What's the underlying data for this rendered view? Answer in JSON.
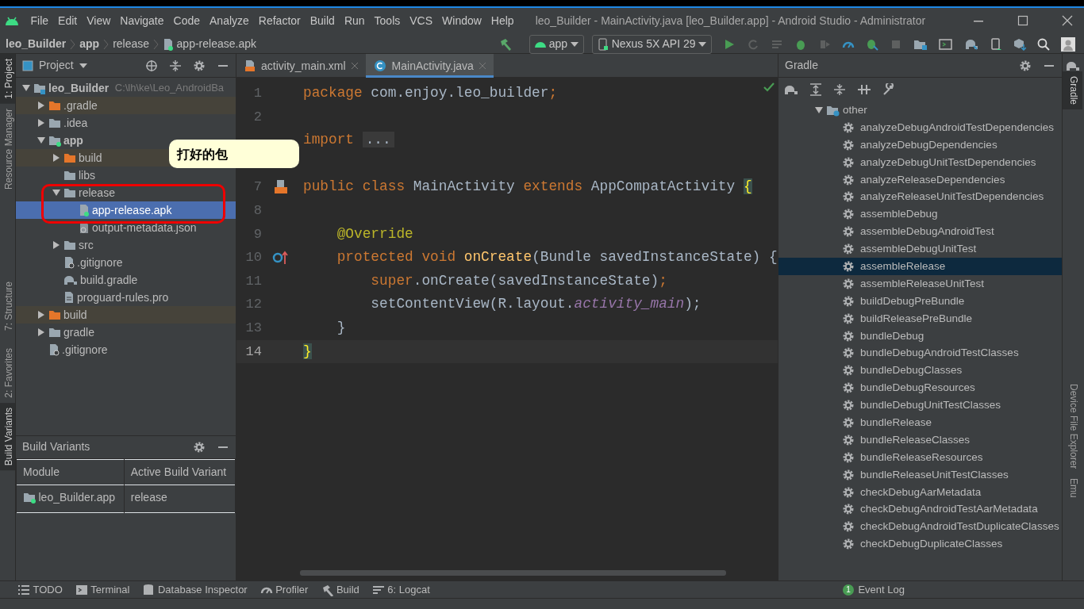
{
  "menu": [
    "File",
    "Edit",
    "View",
    "Navigate",
    "Code",
    "Analyze",
    "Refactor",
    "Build",
    "Run",
    "Tools",
    "VCS",
    "Window",
    "Help"
  ],
  "window_title": "leo_Builder - MainActivity.java [leo_Builder.app] - Android Studio - Administrator",
  "breadcrumb": [
    {
      "label": "leo_Builder",
      "bold": true,
      "kind": "text"
    },
    {
      "label": "app",
      "bold": true,
      "kind": "text"
    },
    {
      "label": "release",
      "bold": false,
      "kind": "text"
    },
    {
      "label": "app-release.apk",
      "bold": false,
      "kind": "apk"
    }
  ],
  "toolbar": {
    "config": "app",
    "device": "Nexus 5X API 29"
  },
  "left_strip": [
    {
      "label": "1: Project",
      "selected": true
    },
    {
      "label": "Resource Manager",
      "selected": false
    },
    {
      "label": "7: Structure",
      "selected": false
    },
    {
      "label": "2: Favorites",
      "selected": false
    },
    {
      "label": "Build Variants",
      "selected": true
    }
  ],
  "project_panel": {
    "title": "Project",
    "tree": [
      {
        "label": "leo_Builder",
        "path": "C:\\lh\\ke\\Leo_AndroidBa",
        "kind": "root",
        "expanded": true,
        "selected": false,
        "children": [
          {
            "label": ".gradle",
            "kind": "build_folder",
            "expanded": false,
            "selected": false
          },
          {
            "label": ".idea",
            "kind": "folder",
            "expanded": false,
            "selected": false
          },
          {
            "label": "app",
            "kind": "module",
            "expanded": true,
            "selected": false,
            "children": [
              {
                "label": "build",
                "kind": "build_folder",
                "expanded": false,
                "selected": false
              },
              {
                "label": "libs",
                "kind": "folder",
                "selected": false
              },
              {
                "label": "release",
                "kind": "folder",
                "expanded": true,
                "selected": false,
                "children": [
                  {
                    "label": "app-release.apk",
                    "kind": "apk",
                    "selected": true
                  },
                  {
                    "label": "output-metadata.json",
                    "kind": "json",
                    "selected": false
                  }
                ]
              },
              {
                "label": "src",
                "kind": "folder",
                "expanded": false,
                "selected": false
              },
              {
                "label": ".gitignore",
                "kind": "ignore",
                "selected": false
              },
              {
                "label": "build.gradle",
                "kind": "gradle",
                "selected": false
              },
              {
                "label": "proguard-rules.pro",
                "kind": "file",
                "selected": false
              }
            ]
          },
          {
            "label": "build",
            "kind": "build_folder",
            "expanded": false,
            "selected": false
          },
          {
            "label": "gradle",
            "kind": "folder",
            "expanded": false,
            "selected": false
          },
          {
            "label": ".gitignore",
            "kind": "ignore",
            "selected": false
          }
        ]
      }
    ]
  },
  "build_variants": {
    "title": "Build Variants",
    "columns": [
      "Module",
      "Active Build Variant"
    ],
    "rows": [
      [
        "leo_Builder.app",
        "release"
      ]
    ]
  },
  "editor_tabs": [
    {
      "label": "activity_main.xml",
      "kind": "xml",
      "selected": false
    },
    {
      "label": "MainActivity.java",
      "kind": "java",
      "selected": true
    }
  ],
  "code": [
    {
      "number": "1",
      "tokens": [
        {
          "kind": "kw",
          "text": "package"
        },
        {
          "kind": "plain",
          "text": " com.enjoy.leo_builder"
        },
        {
          "kind": "kw",
          "text": ";"
        }
      ]
    },
    {
      "number": "2"
    },
    {
      "kind": "folded",
      "tokens": [
        {
          "kind": "kw",
          "text": "import"
        },
        {
          "kind": "fold",
          "text": "..."
        }
      ]
    },
    {
      "number": "7",
      "kind": "layout",
      "tokens": [
        {
          "kind": "kw",
          "text": "public class"
        },
        {
          "kind": "plain",
          "text": " MainActivity "
        },
        {
          "kind": "kw",
          "text": "extends"
        },
        {
          "kind": "plain",
          "text": " AppCompatActivity "
        },
        {
          "kind": "brace",
          "text": "{"
        }
      ]
    },
    {
      "number": "8"
    },
    {
      "number": "9",
      "tokens": [
        {
          "kind": "ann",
          "text": "    @Override"
        }
      ]
    },
    {
      "number": "10",
      "kind": "override",
      "tokens": [
        {
          "kind": "kw",
          "text": "    protected void"
        },
        {
          "kind": "method",
          "text": " onCreate"
        },
        {
          "kind": "plain",
          "text": "(Bundle savedInstanceState) {"
        }
      ]
    },
    {
      "number": "11",
      "tokens": [
        {
          "kind": "kw",
          "text": "        super"
        },
        {
          "kind": "plain",
          "text": ".onCreate(savedInstanceState)"
        },
        {
          "kind": "kw",
          "text": ";"
        }
      ]
    },
    {
      "number": "12",
      "tokens": [
        {
          "kind": "plain",
          "text": "        setContentView(R.layout."
        },
        {
          "kind": "field",
          "text": "activity_main"
        },
        {
          "kind": "plain",
          "text": ");"
        }
      ]
    },
    {
      "number": "13",
      "tokens": [
        {
          "kind": "plain",
          "text": "    }"
        }
      ]
    },
    {
      "number": "14",
      "current": true,
      "tokens": [
        {
          "kind": "brace",
          "text": "}"
        }
      ]
    }
  ],
  "callout": "打好的包",
  "gradle": {
    "title": "Gradle",
    "group": "other",
    "tasks": [
      {
        "label": "analyzeDebugAndroidTestDependencies",
        "selected": false
      },
      {
        "label": "analyzeDebugDependencies",
        "selected": false
      },
      {
        "label": "analyzeDebugUnitTestDependencies",
        "selected": false
      },
      {
        "label": "analyzeReleaseDependencies",
        "selected": false
      },
      {
        "label": "analyzeReleaseUnitTestDependencies",
        "selected": false
      },
      {
        "label": "assembleDebug",
        "selected": false
      },
      {
        "label": "assembleDebugAndroidTest",
        "selected": false
      },
      {
        "label": "assembleDebugUnitTest",
        "selected": false
      },
      {
        "label": "assembleRelease",
        "selected": true
      },
      {
        "label": "assembleReleaseUnitTest",
        "selected": false
      },
      {
        "label": "buildDebugPreBundle",
        "selected": false
      },
      {
        "label": "buildReleasePreBundle",
        "selected": false
      },
      {
        "label": "bundleDebug",
        "selected": false
      },
      {
        "label": "bundleDebugAndroidTestClasses",
        "selected": false
      },
      {
        "label": "bundleDebugClasses",
        "selected": false
      },
      {
        "label": "bundleDebugResources",
        "selected": false
      },
      {
        "label": "bundleDebugUnitTestClasses",
        "selected": false
      },
      {
        "label": "bundleRelease",
        "selected": false
      },
      {
        "label": "bundleReleaseClasses",
        "selected": false
      },
      {
        "label": "bundleReleaseResources",
        "selected": false
      },
      {
        "label": "bundleReleaseUnitTestClasses",
        "selected": false
      },
      {
        "label": "checkDebugAarMetadata",
        "selected": false
      },
      {
        "label": "checkDebugAndroidTestAarMetadata",
        "selected": false
      },
      {
        "label": "checkDebugAndroidTestDuplicateClasses",
        "selected": false
      },
      {
        "label": "checkDebugDuplicateClasses",
        "selected": false
      }
    ]
  },
  "right_strip": [
    {
      "label": "Gradle",
      "selected": true
    },
    {
      "label": "Device File Explorer",
      "selected": false
    },
    {
      "label": "Emu",
      "selected": false
    }
  ],
  "bottom_tools": [
    {
      "label": "TODO",
      "kind": "list"
    },
    {
      "label": "Terminal",
      "kind": "terminal"
    },
    {
      "label": "Database Inspector",
      "kind": "database"
    },
    {
      "label": "Profiler",
      "kind": "gauge"
    },
    {
      "label": "Build",
      "kind": "hammer"
    },
    {
      "label": "6: Logcat",
      "kind": "lines"
    }
  ],
  "event_log": {
    "label": "Event Log",
    "count": "1"
  }
}
